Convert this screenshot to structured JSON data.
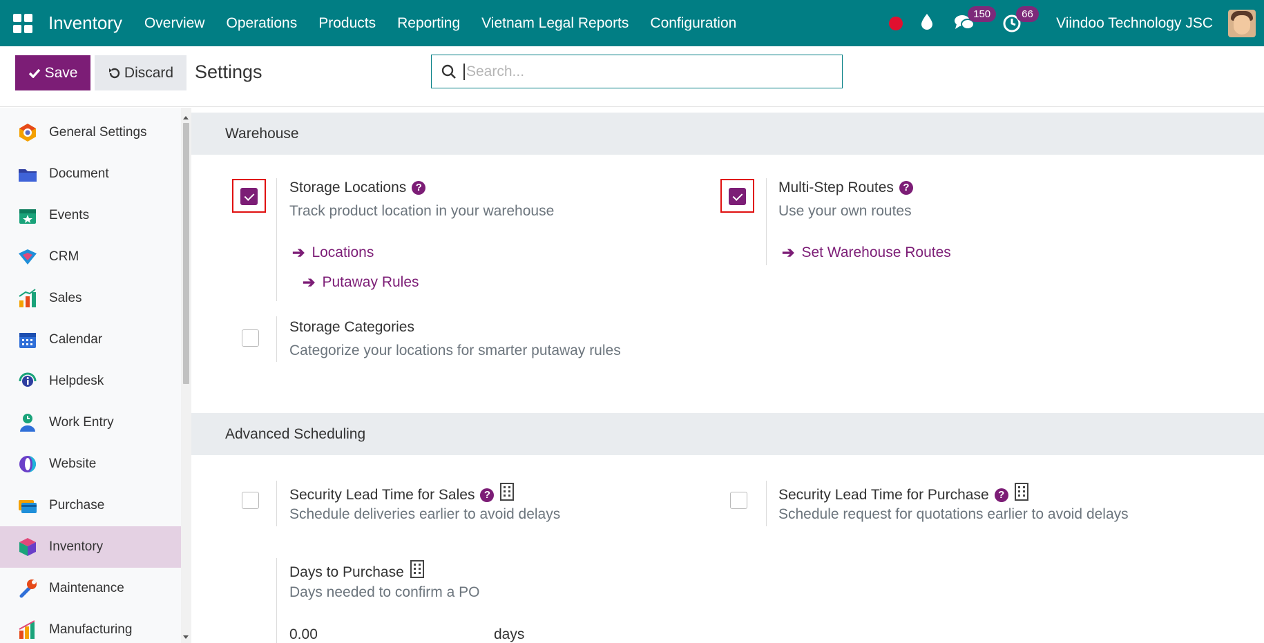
{
  "navbar": {
    "brand": "Inventory",
    "menu": [
      "Overview",
      "Operations",
      "Products",
      "Reporting",
      "Vietnam Legal Reports",
      "Configuration"
    ],
    "messages_count": "150",
    "activities_count": "66",
    "company": "Viindoo Technology JSC"
  },
  "control": {
    "save_label": "Save",
    "discard_label": "Discard",
    "title": "Settings",
    "search_placeholder": "Search..."
  },
  "sidebar": {
    "items": [
      {
        "label": "General Settings",
        "icon": "general-settings-icon"
      },
      {
        "label": "Document",
        "icon": "document-icon"
      },
      {
        "label": "Events",
        "icon": "events-icon"
      },
      {
        "label": "CRM",
        "icon": "crm-icon"
      },
      {
        "label": "Sales",
        "icon": "sales-icon"
      },
      {
        "label": "Calendar",
        "icon": "calendar-icon"
      },
      {
        "label": "Helpdesk",
        "icon": "helpdesk-icon"
      },
      {
        "label": "Work Entry",
        "icon": "work-entry-icon"
      },
      {
        "label": "Website",
        "icon": "website-icon"
      },
      {
        "label": "Purchase",
        "icon": "purchase-icon"
      },
      {
        "label": "Inventory",
        "icon": "inventory-icon",
        "active": true
      },
      {
        "label": "Maintenance",
        "icon": "maintenance-icon"
      },
      {
        "label": "Manufacturing",
        "icon": "manufacturing-icon"
      }
    ]
  },
  "warehouse": {
    "heading": "Warehouse",
    "storage_locations": {
      "title": "Storage Locations",
      "desc": "Track product location in your warehouse",
      "checked": true,
      "links": [
        "Locations",
        "Putaway Rules"
      ]
    },
    "multi_step": {
      "title": "Multi-Step Routes",
      "desc": "Use your own routes",
      "checked": true,
      "links": [
        "Set Warehouse Routes"
      ]
    },
    "storage_categories": {
      "title": "Storage Categories",
      "desc": "Categorize your locations for smarter putaway rules",
      "checked": false
    }
  },
  "scheduling": {
    "heading": "Advanced Scheduling",
    "lead_sales": {
      "title": "Security Lead Time for Sales",
      "desc": "Schedule deliveries earlier to avoid delays",
      "checked": false
    },
    "lead_purchase": {
      "title": "Security Lead Time for Purchase",
      "desc": "Schedule request for quotations earlier to avoid delays",
      "checked": false
    },
    "days_to_purchase": {
      "title": "Days to Purchase",
      "desc": "Days needed to confirm a PO",
      "value": "0.00",
      "unit": "days"
    }
  },
  "colors": {
    "navbar": "#017e84",
    "accent": "#7c1d76",
    "highlight": "#e01010"
  }
}
